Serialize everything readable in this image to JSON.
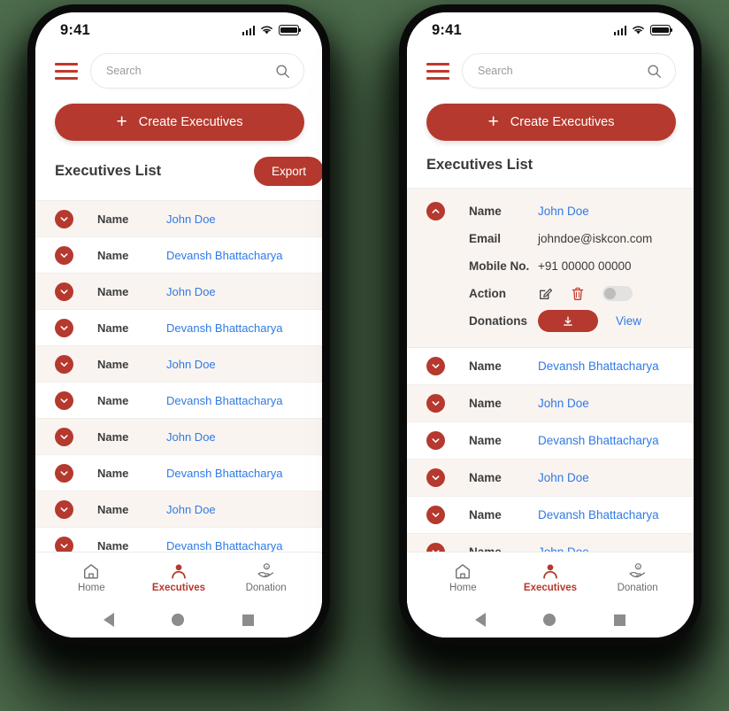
{
  "theme": {
    "accent": "#b5392e",
    "link": "#2f7ae5",
    "row_alt_bg": "#faf4f0",
    "page_bg": "#4d6d4d"
  },
  "status_bar": {
    "time": "9:41",
    "signal_icon": "signal-bars-icon",
    "wifi_icon": "wifi-icon",
    "battery_icon": "battery-full-icon"
  },
  "topbar": {
    "menu_icon": "hamburger-menu-icon",
    "search_placeholder": "Search",
    "search_value": "",
    "search_icon": "search-icon"
  },
  "create_button": {
    "label": "Create Executives",
    "plus_icon": "plus-icon"
  },
  "list_header": {
    "title": "Executives List",
    "export_label": "Export"
  },
  "labels": {
    "name": "Name",
    "email": "Email",
    "mobile": "Mobile No.",
    "action": "Action",
    "donations": "Donations",
    "view": "View"
  },
  "left_phone": {
    "rows": [
      {
        "label": "Name",
        "value": "John Doe"
      },
      {
        "label": "Name",
        "value": "Devansh Bhattacharya"
      },
      {
        "label": "Name",
        "value": "John Doe"
      },
      {
        "label": "Name",
        "value": "Devansh Bhattacharya"
      },
      {
        "label": "Name",
        "value": "John Doe"
      },
      {
        "label": "Name",
        "value": "Devansh Bhattacharya"
      },
      {
        "label": "Name",
        "value": "John Doe"
      },
      {
        "label": "Name",
        "value": "Devansh Bhattacharya"
      },
      {
        "label": "Name",
        "value": "John Doe"
      },
      {
        "label": "Name",
        "value": "Devansh Bhattacharya"
      }
    ]
  },
  "right_phone": {
    "expanded": {
      "name_label": "Name",
      "name_value": "John Doe",
      "email_label": "Email",
      "email_value": "johndoe@iskcon.com",
      "mobile_label": "Mobile No.",
      "mobile_value": "+91 00000 00000",
      "action_label": "Action",
      "edit_icon": "edit-pencil-icon",
      "delete_icon": "trash-delete-icon",
      "toggle_state": "off",
      "donations_label": "Donations",
      "download_icon": "download-icon",
      "view_label": "View",
      "collapse_icon": "chevron-up-icon"
    },
    "rows": [
      {
        "label": "Name",
        "value": "Devansh Bhattacharya"
      },
      {
        "label": "Name",
        "value": "John Doe"
      },
      {
        "label": "Name",
        "value": "Devansh Bhattacharya"
      },
      {
        "label": "Name",
        "value": "John Doe"
      },
      {
        "label": "Name",
        "value": "Devansh Bhattacharya"
      },
      {
        "label": "Name",
        "value": "John Doe"
      }
    ]
  },
  "bottom_nav": {
    "items": [
      {
        "label": "Home",
        "icon": "home-icon",
        "active": false
      },
      {
        "label": "Executives",
        "icon": "person-icon",
        "active": true
      },
      {
        "label": "Donation",
        "icon": "donation-hand-coin-icon",
        "active": false
      }
    ]
  },
  "android_nav": {
    "back_icon": "android-back-icon",
    "home_icon": "android-home-icon",
    "recents_icon": "android-recents-icon"
  }
}
